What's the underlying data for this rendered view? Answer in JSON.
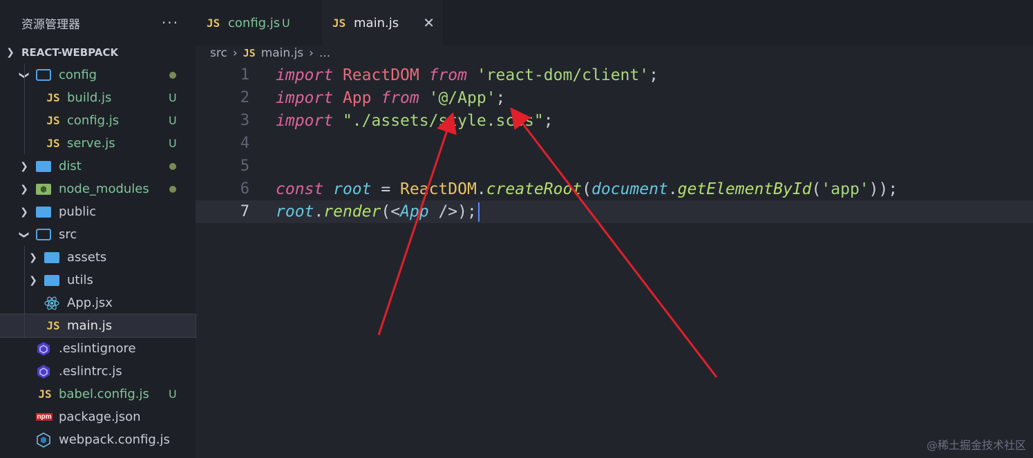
{
  "sidebar": {
    "title": "资源管理器",
    "more": "···",
    "root": "REACT-WEBPACK",
    "items": [
      {
        "label": "config",
        "status": "dot"
      },
      {
        "label": "build.js",
        "status": "U"
      },
      {
        "label": "config.js",
        "status": "U"
      },
      {
        "label": "serve.js",
        "status": "U"
      },
      {
        "label": "dist",
        "status": "dot"
      },
      {
        "label": "node_modules",
        "status": "dot"
      },
      {
        "label": "public",
        "status": ""
      },
      {
        "label": "src",
        "status": ""
      },
      {
        "label": "assets",
        "status": ""
      },
      {
        "label": "utils",
        "status": ""
      },
      {
        "label": "App.jsx",
        "status": ""
      },
      {
        "label": "main.js",
        "status": ""
      },
      {
        "label": ".eslintignore",
        "status": ""
      },
      {
        "label": ".eslintrc.js",
        "status": ""
      },
      {
        "label": "babel.config.js",
        "status": "U"
      },
      {
        "label": "package.json",
        "status": ""
      },
      {
        "label": "webpack.config.js",
        "status": ""
      }
    ],
    "js_icon": "JS",
    "npm_icon": "npm"
  },
  "tabs": [
    {
      "label": "config.js",
      "badge": "U",
      "icon": "JS"
    },
    {
      "label": "main.js",
      "close": "✕",
      "icon": "JS"
    }
  ],
  "breadcrumb": {
    "dir": "src",
    "sep": "›",
    "file": "main.js",
    "icon": "JS",
    "ellipsis": "..."
  },
  "editor": {
    "line_numbers": [
      "1",
      "2",
      "3",
      "4",
      "5",
      "6",
      "7"
    ],
    "current_line": 7,
    "lines": [
      [
        [
          "import",
          "kw"
        ],
        [
          " ",
          "pun"
        ],
        [
          "ReactDOM",
          "id"
        ],
        [
          " ",
          "pun"
        ],
        [
          "from",
          "kw"
        ],
        [
          " ",
          "pun"
        ],
        [
          "'react-dom/client'",
          "str"
        ],
        [
          ";",
          "pun"
        ]
      ],
      [
        [
          "import",
          "kw"
        ],
        [
          " ",
          "pun"
        ],
        [
          "App",
          "id"
        ],
        [
          " ",
          "pun"
        ],
        [
          "from",
          "kw"
        ],
        [
          " ",
          "pun"
        ],
        [
          "'@/App'",
          "str"
        ],
        [
          ";",
          "pun"
        ]
      ],
      [
        [
          "import",
          "kw"
        ],
        [
          " ",
          "pun"
        ],
        [
          "\"./assets/style.scss\"",
          "str"
        ],
        [
          ";",
          "pun"
        ]
      ],
      [],
      [],
      [
        [
          "const",
          "kw"
        ],
        [
          " ",
          "pun"
        ],
        [
          "root",
          "var"
        ],
        [
          " = ",
          "pun"
        ],
        [
          "ReactDOM",
          "cls"
        ],
        [
          ".",
          "pun"
        ],
        [
          "createRoot",
          "fn"
        ],
        [
          "(",
          "pun"
        ],
        [
          "document",
          "var"
        ],
        [
          ".",
          "pun"
        ],
        [
          "getElementById",
          "fn"
        ],
        [
          "(",
          "pun"
        ],
        [
          "'app'",
          "str"
        ],
        [
          "));",
          "pun"
        ]
      ],
      [
        [
          "root",
          "var"
        ],
        [
          ".",
          "pun"
        ],
        [
          "render",
          "fn"
        ],
        [
          "(<",
          "pun"
        ],
        [
          "App",
          "var"
        ],
        [
          " />);",
          "pun"
        ]
      ]
    ]
  },
  "watermark": "@稀土掘金技术社区",
  "colors": {
    "arrow": "#e0202a",
    "accent": "#5b8cff"
  }
}
